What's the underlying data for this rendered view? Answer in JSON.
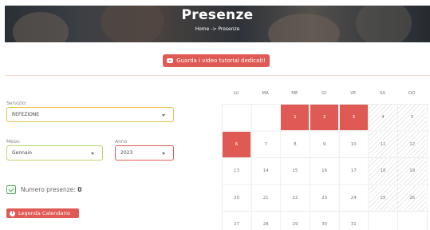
{
  "header": {
    "title": "Presenze",
    "breadcrumb": "Home -> Presenze"
  },
  "tutorial_button": "Guarda i video tutorial dedicati!",
  "filters": {
    "servizio_label": "Servizio:",
    "servizio_value": "REFEZIONE",
    "mese_label": "Mese:",
    "mese_value": "Gennaio",
    "anno_label": "Anno",
    "anno_value": "2023"
  },
  "presenze": {
    "label": "Numero presenze:",
    "count": "0"
  },
  "legend_button": "Legenda Calendario",
  "calendar": {
    "weekdays": [
      "LU",
      "MA",
      "ME",
      "GI",
      "VE",
      "SA",
      "DO"
    ],
    "weeks": [
      [
        "",
        "",
        "1",
        "2",
        "3",
        "4",
        "5"
      ],
      [
        "6",
        "7",
        "8",
        "9",
        "10",
        "11",
        "12"
      ],
      [
        "13",
        "14",
        "15",
        "16",
        "17",
        "18",
        "19"
      ],
      [
        "20",
        "21",
        "22",
        "23",
        "24",
        "25",
        "26"
      ],
      [
        "27",
        "28",
        "29",
        "30",
        "31",
        "",
        ""
      ]
    ],
    "highlighted_days": [
      "1",
      "2",
      "3",
      "6"
    ],
    "highlight_color": "#e05a55"
  },
  "colors": {
    "accent_red": "#e05a55",
    "yellow_border": "#e8c04a",
    "green_border": "#b9d86a",
    "check_green": "#4caf50"
  }
}
